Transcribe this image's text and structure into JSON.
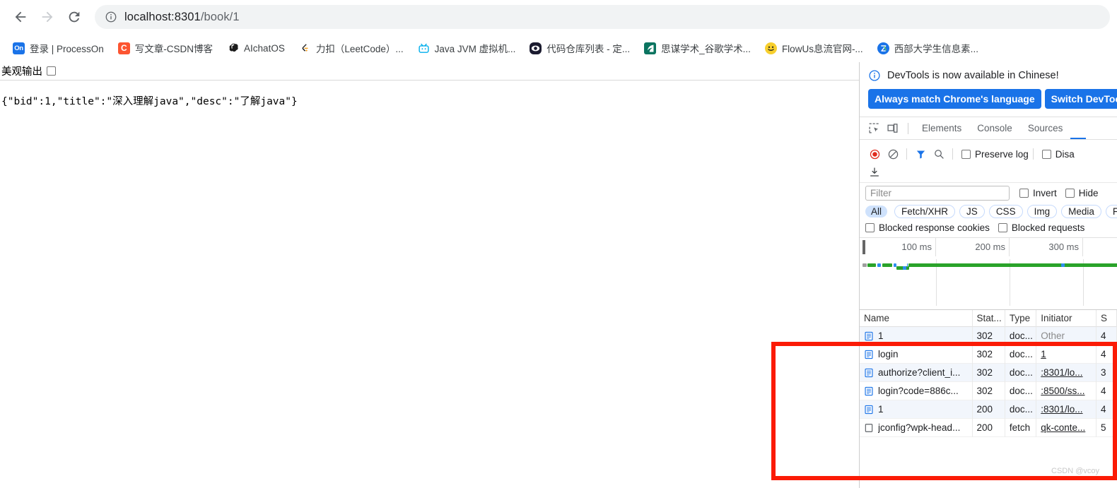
{
  "browser": {
    "back_label": "Back",
    "forward_label": "Forward",
    "reload_label": "Reload",
    "url_host": "localhost:8301",
    "url_path": "/book/1",
    "url_full": "localhost:8301/book/1",
    "site_info_icon": "info-circle-icon"
  },
  "bookmarks": [
    {
      "label": "登录 | ProcessOn",
      "icon": "processon-icon",
      "icon_text": "On",
      "icon_class": "ico-on"
    },
    {
      "label": "写文章-CSDN博客",
      "icon": "csdn-icon",
      "icon_text": "C",
      "icon_class": "ico-c"
    },
    {
      "label": "AIchatOS",
      "icon": "aichatos-icon",
      "icon_text": "",
      "icon_class": "ico-ai"
    },
    {
      "label": "力扣（LeetCode）...",
      "icon": "leetcode-icon",
      "icon_text": "",
      "icon_class": "ico-lc"
    },
    {
      "label": "Java JVM 虚拟机...",
      "icon": "bilibili-icon",
      "icon_text": "",
      "icon_class": "ico-jvm"
    },
    {
      "label": "代码仓库列表 - 定...",
      "icon": "repository-icon",
      "icon_text": "",
      "icon_class": "ico-repo"
    },
    {
      "label": "思谋学术_谷歌学术...",
      "icon": "scholar-icon",
      "icon_text": "",
      "icon_class": "ico-smart"
    },
    {
      "label": "FlowUs息流官网-...",
      "icon": "flowus-icon",
      "icon_text": "",
      "icon_class": "ico-flow"
    },
    {
      "label": "西部大学生信息素...",
      "icon": "western-student-icon",
      "icon_text": "",
      "icon_class": "ico-west"
    }
  ],
  "page": {
    "pretty_print_label": "美观输出",
    "pretty_print_checked": false,
    "json_body": "{\"bid\":1,\"title\":\"深入理解java\",\"desc\":\"了解java\"}"
  },
  "devtools": {
    "banner": {
      "icon": "info-circle-icon",
      "message": "DevTools is now available in Chinese!",
      "primary_button": "Always match Chrome's language",
      "secondary_button": "Switch DevToo"
    },
    "tools": [
      {
        "name": "inspect-element-icon"
      },
      {
        "name": "device-toolbar-icon"
      }
    ],
    "tabs": [
      {
        "label": "Elements",
        "active": false
      },
      {
        "label": "Console",
        "active": false
      },
      {
        "label": "Sources",
        "active": false
      },
      {
        "label": "",
        "active": true
      }
    ],
    "network_toolbar": {
      "record_label": "Record network log",
      "clear_label": "Clear",
      "filter_label": "Filter",
      "search_label": "Search",
      "preserve_log_label": "Preserve log",
      "preserve_log_checked": false,
      "disable_cache_label": "Disa",
      "disable_cache_checked": false,
      "export_label": "Export HAR"
    },
    "filter": {
      "placeholder": "Filter",
      "value": "",
      "invert_label": "Invert",
      "invert_checked": false,
      "hide_label": "Hide",
      "hide_checked": false
    },
    "resource_types": [
      "All",
      "Fetch/XHR",
      "JS",
      "CSS",
      "Img",
      "Media",
      "Fo"
    ],
    "resource_type_selected": "All",
    "blocked": {
      "response_cookies_label": "Blocked response cookies",
      "response_cookies_checked": false,
      "requests_label": "Blocked requests",
      "requests_checked": false
    },
    "overview": {
      "ticks": [
        "100 ms",
        "200 ms",
        "300 ms"
      ]
    },
    "table": {
      "columns": [
        "Name",
        "Stat...",
        "Type",
        "Initiator",
        "S"
      ],
      "rows": [
        {
          "icon": "document-icon",
          "name": "1",
          "status": "302",
          "type": "doc...",
          "initiator": "Other",
          "initiator_link": false,
          "size": "4"
        },
        {
          "icon": "document-icon",
          "name": "login",
          "status": "302",
          "type": "doc...",
          "initiator": "1",
          "initiator_link": true,
          "size": "4"
        },
        {
          "icon": "document-icon",
          "name": "authorize?client_i...",
          "status": "302",
          "type": "doc...",
          "initiator": ":8301/lo...",
          "initiator_link": true,
          "size": "3"
        },
        {
          "icon": "document-icon",
          "name": "login?code=886c...",
          "status": "302",
          "type": "doc...",
          "initiator": ":8500/ss...",
          "initiator_link": true,
          "size": "4"
        },
        {
          "icon": "document-icon",
          "name": "1",
          "status": "200",
          "type": "doc...",
          "initiator": ":8301/lo...",
          "initiator_link": true,
          "size": "4"
        },
        {
          "icon": "generic-file-icon",
          "name": "jconfig?wpk-head...",
          "status": "200",
          "type": "fetch",
          "initiator": "qk-conte...",
          "initiator_link": true,
          "size": "5"
        }
      ]
    }
  },
  "annotation": {
    "color": "#fb1b05",
    "watermark": "CSDN @vcoy"
  }
}
